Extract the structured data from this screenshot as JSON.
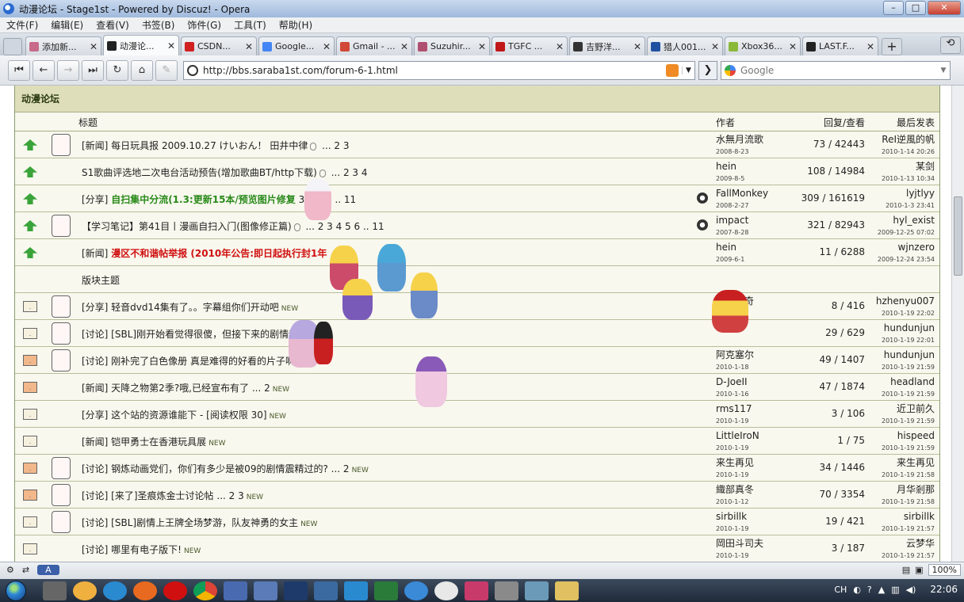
{
  "window": {
    "title": "动漫论坛 - Stage1st - Powered by Discuz! - Opera"
  },
  "menu": [
    "文件(F)",
    "编辑(E)",
    "查看(V)",
    "书签(B)",
    "饰件(G)",
    "工具(T)",
    "帮助(H)"
  ],
  "tabs": [
    {
      "label": "添加新...",
      "color": "#c86a8a"
    },
    {
      "label": "动漫论...",
      "color": "#222222"
    },
    {
      "label": "CSDN...",
      "color": "#d02020"
    },
    {
      "label": "Google...",
      "color": "#4285f4"
    },
    {
      "label": "Gmail - ...",
      "color": "#d14836"
    },
    {
      "label": "Suzuhir...",
      "color": "#b05070"
    },
    {
      "label": "TGFC ...",
      "color": "#c01818"
    },
    {
      "label": "吉野洋...",
      "color": "#333333"
    },
    {
      "label": "猎人001...",
      "color": "#2050a0"
    },
    {
      "label": "Xbox36...",
      "color": "#8ab838"
    },
    {
      "label": "LAST.F...",
      "color": "#222222"
    }
  ],
  "address": {
    "url": "http://bbs.saraba1st.com/forum-6-1.html"
  },
  "search": {
    "placeholder": "Google"
  },
  "forum": {
    "title": "动漫论坛",
    "columns": {
      "subject": "标题",
      "author": "作者",
      "replies": "回复/查看",
      "last": "最后发表"
    },
    "sticky": [
      {
        "title": "[新闻] 每日玩具报 2009.10.27 けいおん！ 田井中律",
        "clip": true,
        "pages": "... 2 3",
        "author": "水無月流歌",
        "adate": "2008-8-23",
        "replies": "73 / 42443",
        "last": "ReI逆風的帆",
        "ldate": "2010-1-14 20:26",
        "face": true
      },
      {
        "title": "S1歌曲评选地二次电台活动预告(增加歌曲BT/http下载)",
        "clip": true,
        "pages": "... 2 3 4",
        "author": "hein",
        "adate": "2009-8-5",
        "replies": "108 / 14984",
        "last": "某剑",
        "ldate": "2010-1-13 10:34",
        "face": false
      },
      {
        "prefix": "[分享] ",
        "title": "自扫集中分流(1.3:更新15本/预览图片修复",
        "style": "green",
        "pages": "3 4 5 6 .. 11",
        "author": "FallMonkey",
        "adate": "2008-2-27",
        "replies": "309 / 161619",
        "last": "lyjtlyy",
        "ldate": "2010-1-3 23:41",
        "att": true,
        "face": false
      },
      {
        "title": "【学习笔记】第41目丨漫画自扫入门(图像修正篇)",
        "clip": true,
        "pages": "... 2 3 4 5 6 .. 11",
        "author": "impact",
        "adate": "2007-8-28",
        "replies": "321 / 82943",
        "last": "hyl_exist",
        "ldate": "2009-12-25 07:02",
        "att": true,
        "face": true
      },
      {
        "prefix": "[新闻] ",
        "title": "漫区不和谐帖举报 (2010年公告:即日起执行封1年",
        "style": "red",
        "pages": "",
        "author": "hein",
        "adate": "2009-6-1",
        "replies": "11 / 6288",
        "last": "wjnzero",
        "ldate": "2009-12-24 23:54",
        "face": false
      }
    ],
    "section_label": "版块主题",
    "threads": [
      {
        "title": "[分享] 轻音dvd14集有了。。字幕组你们开动吧",
        "new": "NEW",
        "pages": "",
        "author": "阿克塞奇",
        "adate": "",
        "replies": "8 / 416",
        "last": "hzhenyu007",
        "ldate": "2010-1-19 22:02",
        "face": true,
        "hot": false
      },
      {
        "title": "[讨论] [SBL]刚开始看觉得很傻，但接下来的剧情越",
        "new": "NEW",
        "pages": "",
        "author": "",
        "adate": "",
        "replies": "29 / 629",
        "last": "hundunjun",
        "ldate": "2010-1-19 22:01",
        "face": true,
        "hot": false
      },
      {
        "title": "[讨论] 刚补完了白色像册 真是难得的好看的片子啊.",
        "new": "NEW",
        "pages": "",
        "author": "阿克塞尔",
        "adate": "2010-1-18",
        "replies": "49 / 1407",
        "last": "hundunjun",
        "ldate": "2010-1-19 21:59",
        "face": true,
        "hot": true
      },
      {
        "title": "[新闻] 天降之物第2季?哦,已经宣布有了",
        "new": "NEW",
        "pages": "... 2",
        "author": "D-JoeII",
        "adate": "2010-1-16",
        "replies": "47 / 1874",
        "last": "headland",
        "ldate": "2010-1-19 21:59",
        "face": false,
        "hot": true
      },
      {
        "title": "[分享] 这个站的资源谁能下 - [阅读权限 30]",
        "new": "NEW",
        "pages": "",
        "author": "rms117",
        "adate": "2010-1-19",
        "replies": "3 / 106",
        "last": "近卫前久",
        "ldate": "2010-1-19 21:59",
        "face": false,
        "hot": false
      },
      {
        "title": "[新闻] 铠甲勇士在香港玩具展",
        "new": "NEW",
        "pages": "",
        "author": "LittleIroN",
        "adate": "2010-1-19",
        "replies": "1 / 75",
        "last": "hispeed",
        "ldate": "2010-1-19 21:59",
        "face": false,
        "hot": false
      },
      {
        "title": "[讨论] 钢炼动画党们，你们有多少是被09的剧情震精过的?",
        "new": "NEW",
        "pages": "... 2",
        "author": "来生再见",
        "adate": "2010-1-19",
        "replies": "34 / 1446",
        "last": "来生再见",
        "ldate": "2010-1-19 21:58",
        "face": true,
        "hot": true
      },
      {
        "title": "[讨论] [来了]圣痕炼金士讨论帖",
        "new": "NEW",
        "pages": "... 2 3",
        "author": "織部真冬",
        "adate": "2010-1-12",
        "replies": "70 / 3354",
        "last": "月华剎那",
        "ldate": "2010-1-19 21:58",
        "face": true,
        "hot": true
      },
      {
        "title": "[讨论] [SBL]剧情上王牌全场梦游，队友神勇的女主",
        "new": "NEW",
        "pages": "",
        "author": "sirbillk",
        "adate": "2010-1-19",
        "replies": "19 / 421",
        "last": "sirbillk",
        "ldate": "2010-1-19 21:57",
        "face": true,
        "hot": false
      },
      {
        "title": "[讨论] 哪里有电子版下!",
        "new": "NEW",
        "pages": "",
        "author": "岡田斗司夫",
        "adate": "2010-1-19",
        "replies": "3 / 187",
        "last": "云梦华",
        "ldate": "2010-1-19 21:57",
        "face": false,
        "hot": false
      }
    ]
  },
  "status": {
    "zoom": "100%",
    "mode": "A"
  },
  "tray": {
    "lang": "CH",
    "time": "22:06"
  }
}
